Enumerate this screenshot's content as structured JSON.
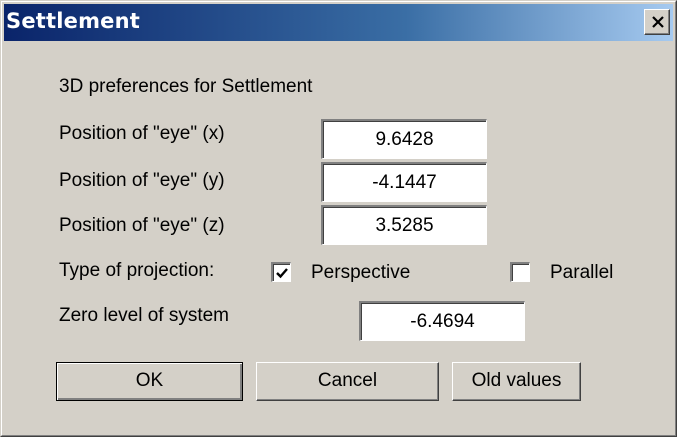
{
  "window": {
    "title": "Settlement",
    "close_glyph": "✕"
  },
  "dialog": {
    "heading": "3D preferences for Settlement",
    "eye_x": {
      "label": "Position of \"eye\" (x)",
      "value": "9.6428"
    },
    "eye_y": {
      "label": "Position of \"eye\" (y)",
      "value": "-4.1447"
    },
    "eye_z": {
      "label": "Position of \"eye\" (z)",
      "value": "3.5285"
    },
    "projection": {
      "label": "Type of projection:",
      "perspective": {
        "label": "Perspective",
        "checked": true
      },
      "parallel": {
        "label": "Parallel",
        "checked": false
      }
    },
    "zero_level": {
      "label": "Zero level of system",
      "value": "-6.4694"
    }
  },
  "buttons": {
    "ok": "OK",
    "cancel": "Cancel",
    "old_values": "Old values"
  }
}
